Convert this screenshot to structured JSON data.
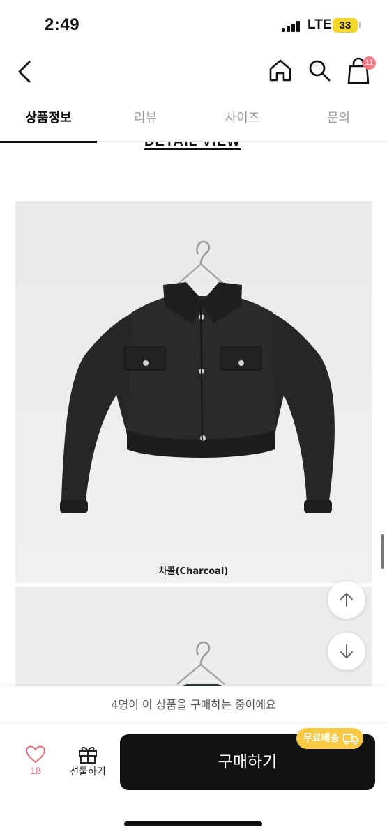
{
  "status_bar": {
    "time": "2:49",
    "network": "LTE",
    "battery": "33"
  },
  "nav": {
    "back_icon": "chevron-left-icon",
    "home_icon": "home-icon",
    "search_icon": "search-icon",
    "cart_icon": "shopping-bag-icon",
    "cart_count": "11"
  },
  "tabs": [
    {
      "label": "상품정보",
      "active": true
    },
    {
      "label": "리뷰",
      "active": false
    },
    {
      "label": "사이즈",
      "active": false
    },
    {
      "label": "문의",
      "active": false
    }
  ],
  "content": {
    "heading": "DETAIL VIEW",
    "photos": [
      {
        "caption": "차콜(Charcoal)"
      },
      {
        "caption": ""
      }
    ]
  },
  "floating_buttons": {
    "up_icon": "arrow-up-icon",
    "down_icon": "arrow-down-icon"
  },
  "bottom": {
    "buying_now": "4명이 이 상품을 구매하는 중이에요",
    "like_count": "18",
    "gift_label": "선물하기",
    "buy_label": "구매하기",
    "free_shipping": "무료배송"
  },
  "colors": {
    "accent_pink": "#f37a84",
    "like_pink": "#e36f7c",
    "shipping_yellow": "#f7c944",
    "buy_button": "#111111"
  }
}
